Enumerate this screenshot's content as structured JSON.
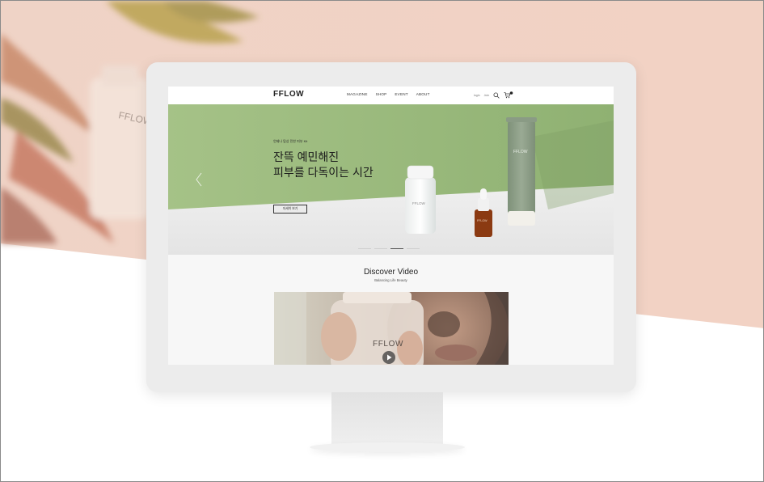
{
  "site": {
    "logo": "FFLOW",
    "nav_items": [
      "MAGAZINE",
      "SHOP",
      "EVENT",
      "ABOUT"
    ],
    "util": {
      "login": "login",
      "join": "Join"
    }
  },
  "hero": {
    "subtitle": "언제나 탐상 민한 피부 Kit",
    "title": "잔뜩 예민해진\n피부를 다독이는 시간",
    "button_label": "자세히 보기",
    "product_brand": "FFLOW",
    "prev_icon": "chevron-left-icon",
    "slides_total": 4,
    "active_slide": 3
  },
  "discover": {
    "title": "Discover Video",
    "subtitle": "Balancing Life Beauty",
    "video_brand": "FFLOW"
  },
  "background_brand": "FFLOW",
  "colors": {
    "peach": "#f1d5c9",
    "hero_green": "#9dbb7f",
    "tube_green": "#8fa08a"
  }
}
